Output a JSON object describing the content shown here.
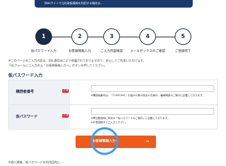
{
  "banner": {
    "text": "Webサイトで当社取扱情報を利用する場合は…"
  },
  "steps": [
    {
      "num": "1",
      "label": "仮パスワード入力",
      "active": true
    },
    {
      "num": "2",
      "label": "お客様情報入力",
      "active": false
    },
    {
      "num": "3",
      "label": "ご入力内容確認",
      "active": false
    },
    {
      "num": "4",
      "label": "メールボックスのご確認",
      "active": false
    },
    {
      "num": "5",
      "label": "ご登録完了",
      "active": false
    }
  ],
  "notice": {
    "line1": "※このページのご入力内容は、SSL通信化により保護されておりますので、安心してご利用いただけます。",
    "line2": "下記フォームにご入力の上「お客様情報入力へ」ボタンを押してください。"
  },
  "section_title": "仮パスワード入力",
  "form": {
    "subscriber": {
      "label": "購読者番号",
      "required": "必須",
      "value": "",
      "help": "※購読者番号は、『TOPPOINT』お届けの際の宛名の右肩中、番線隣接のご案内に記載しております。"
    },
    "password": {
      "label": "仮パスワード",
      "required": "必須",
      "value": "",
      "help1": "※弊社郵送時に同封の「仮パスワードのご案内」に記載しております。",
      "help2": "※半角英数字でご入力ください。"
    }
  },
  "submit": {
    "label": "お客様情報入力へ",
    "arrow": "→"
  },
  "footer": "※個人情報、仮パスワードを利用目的に…"
}
